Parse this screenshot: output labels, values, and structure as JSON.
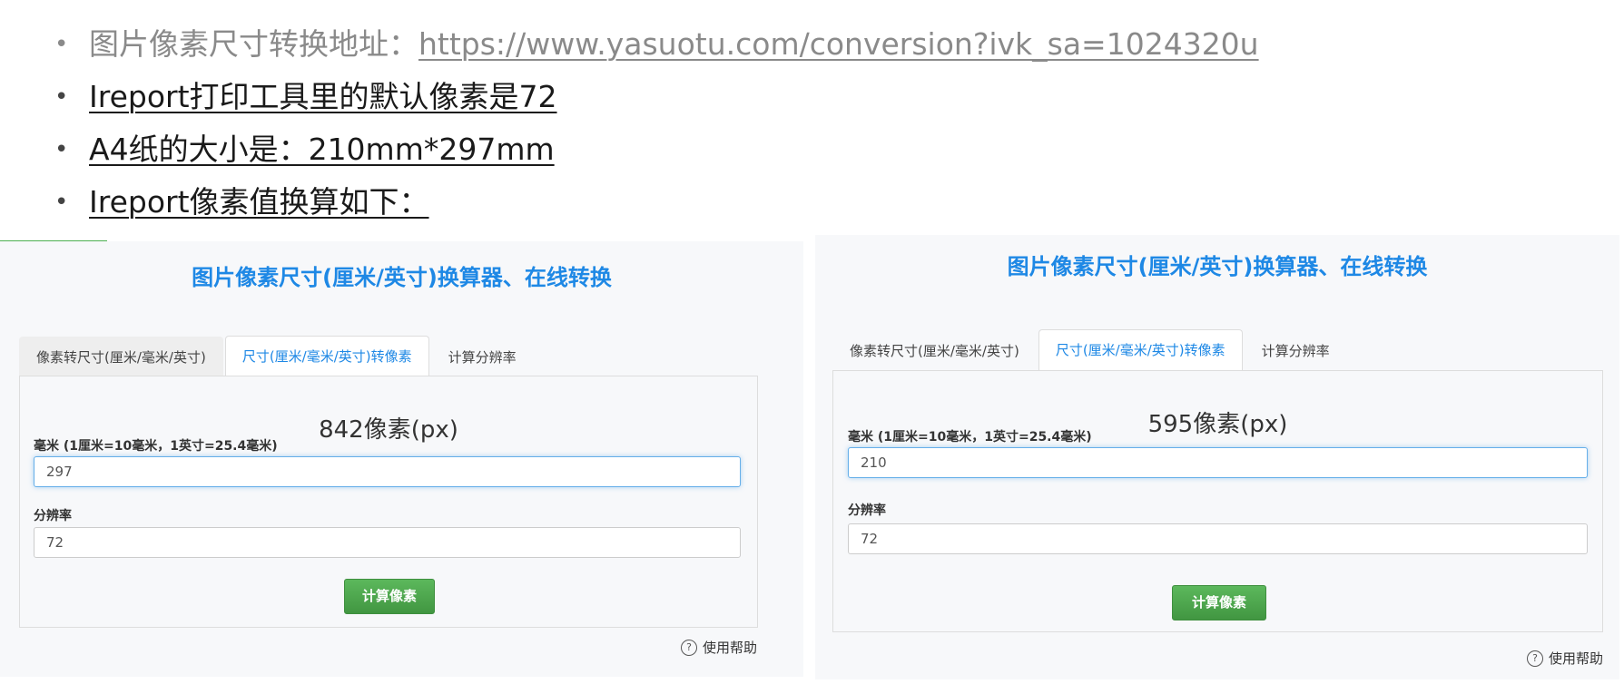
{
  "bullets": [
    {
      "text": "图片像素尺寸转换地址：",
      "link": "https://www.yasuotu.com/conversion?ivk_sa=1024320u"
    },
    {
      "text": "Ireport打印工具里的默认像素是72"
    },
    {
      "text": "A4纸的大小是：210mm*297mm"
    },
    {
      "text": "Ireport像素值换算如下："
    }
  ],
  "bullet_glyph": "•",
  "panels": [
    {
      "title": "图片像素尺寸(厘米/英寸)换算器、在线转换",
      "tabs": [
        {
          "label": "像素转尺寸(厘米/毫米/英寸)",
          "state": "inactive"
        },
        {
          "label": "尺寸(厘米/毫米/英寸)转像素",
          "state": "active"
        },
        {
          "label": "计算分辨率",
          "state": "plain"
        }
      ],
      "result": "842像素(px)",
      "mm_label": "毫米 (1厘米=10毫米，1英寸=25.4毫米)",
      "mm_value": "297",
      "res_label": "分辨率",
      "res_value": "72",
      "button": "计算像素",
      "help": "使用帮助"
    },
    {
      "title": "图片像素尺寸(厘米/英寸)换算器、在线转换",
      "tabs": [
        {
          "label": "像素转尺寸(厘米/毫米/英寸)",
          "state": "plain"
        },
        {
          "label": "尺寸(厘米/毫米/英寸)转像素",
          "state": "active"
        },
        {
          "label": "计算分辨率",
          "state": "plain"
        }
      ],
      "result": "595像素(px)",
      "mm_label": "毫米 (1厘米=10毫米，1英寸=25.4毫米)",
      "mm_value": "210",
      "res_label": "分辨率",
      "res_value": "72",
      "button": "计算像素",
      "help": "使用帮助"
    }
  ],
  "help_icon_glyph": "?",
  "colors": {
    "accent_blue": "#1e88e5",
    "button_green": "#4cae4c",
    "focus_border": "#66afe9",
    "link_gray": "#8a8a8a"
  },
  "icons": [
    "help-circle-icon"
  ]
}
